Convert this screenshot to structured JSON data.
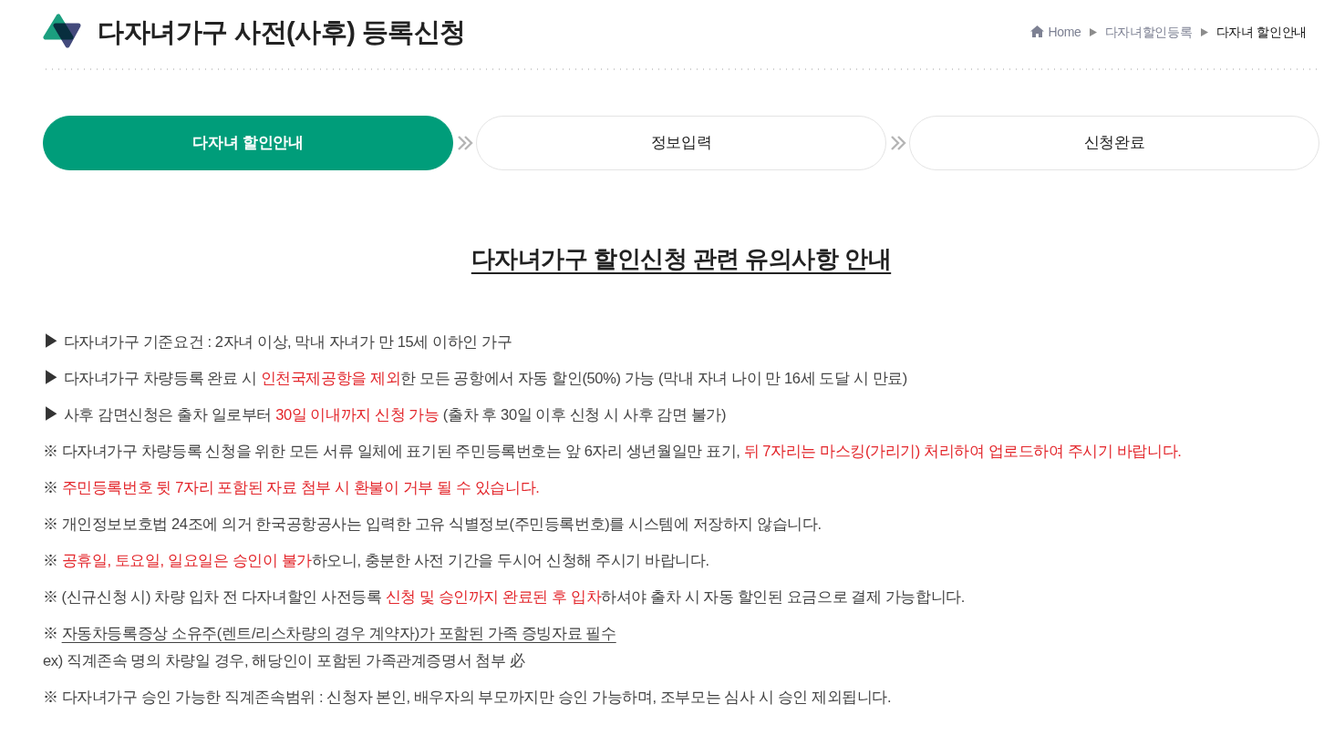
{
  "header": {
    "title": "다자녀가구 사전(사후) 등록신청",
    "breadcrumb": [
      {
        "label": "Home",
        "current": false
      },
      {
        "label": "다자녀할인등록",
        "current": false
      },
      {
        "label": "다자녀 할인안내",
        "current": true
      }
    ]
  },
  "steps": [
    {
      "label": "다자녀 할인안내",
      "selected": true
    },
    {
      "label": "정보입력",
      "selected": false
    },
    {
      "label": "신청완료",
      "selected": false
    }
  ],
  "notice": {
    "title": "다자녀가구 할인신청 관련 유의사항 안내",
    "items": [
      {
        "kind": "arrow",
        "marker": "▶",
        "segments": [
          {
            "kind": "plain",
            "text": "다자녀가구 기준요건 : 2자녀 이상, 막내 자녀가 만 15세 이하인 가구"
          }
        ]
      },
      {
        "kind": "arrow",
        "marker": "▶",
        "segments": [
          {
            "kind": "plain",
            "text": "다자녀가구 차량등록 완료 시 "
          },
          {
            "kind": "warning",
            "text": "인천국제공항을 제외"
          },
          {
            "kind": "plain",
            "text": "한 모든 공항에서 자동 할인(50%) 가능 (막내 자녀 나이 만 16세 도달 시 만료)"
          }
        ]
      },
      {
        "kind": "arrow",
        "marker": "▶",
        "segments": [
          {
            "kind": "plain",
            "text": "사후 감면신청은 출차 일로부터 "
          },
          {
            "kind": "warning",
            "text": "30일 이내까지 신청 가능"
          },
          {
            "kind": "plain",
            "text": " (출차 후 30일 이후 신청 시 사후 감면 불가)"
          }
        ]
      },
      {
        "kind": "reference",
        "marker": "※",
        "segments": [
          {
            "kind": "plain",
            "text": "다자녀가구 차량등록 신청을 위한 모든 서류 일체에 표기된 주민등록번호는 앞 6자리 생년월일만 표기, "
          },
          {
            "kind": "warning",
            "text": "뒤 7자리는 마스킹(가리기) 처리하여 업로드하여 주시기 바랍니다."
          }
        ]
      },
      {
        "kind": "reference",
        "marker": "※",
        "segments": [
          {
            "kind": "warning",
            "text": "주민등록번호 뒷 7자리 포함된 자료 첨부 시 환불이 거부 될 수 있습니다."
          }
        ]
      },
      {
        "kind": "reference",
        "marker": "※",
        "segments": [
          {
            "kind": "plain",
            "text": "개인정보보호법 24조에 의거 한국공항공사는 입력한 고유 식별정보(주민등록번호)를 시스템에 저장하지 않습니다."
          }
        ]
      },
      {
        "kind": "reference",
        "marker": "※",
        "segments": [
          {
            "kind": "warning",
            "text": "공휴일, 토요일, 일요일은 승인이 불가"
          },
          {
            "kind": "plain",
            "text": "하오니, 충분한 사전 기간을 두시어 신청해 주시기 바랍니다."
          }
        ]
      },
      {
        "kind": "reference",
        "marker": "※",
        "segments": [
          {
            "kind": "plain",
            "text": "(신규신청 시) 차량 입차 전 다자녀할인 사전등록 "
          },
          {
            "kind": "warning",
            "text": "신청 및 승인까지 완료된 후 입차"
          },
          {
            "kind": "plain",
            "text": "하셔야 출차 시 자동 할인된 요금으로 결제 가능합니다."
          }
        ]
      },
      {
        "kind": "reference",
        "marker": "※",
        "segments": [
          {
            "kind": "underlined",
            "text": "자동차등록증상 소유주(렌트/리스차량의 경우 계약자)가 포함된 가족 증빙자료 필수"
          }
        ],
        "note": "ex) 직계존속 명의 차량일 경우, 해당인이 포함된 가족관계증명서 첨부 必"
      },
      {
        "kind": "reference",
        "marker": "※",
        "segments": [
          {
            "kind": "plain",
            "text": "다자녀가구 승인 가능한 직계존속범위 : 신청자 본인, 배우자의 부모까지만 승인 가능하며, 조부모는 심사 시 승인 제외됩니다."
          }
        ]
      }
    ]
  }
}
